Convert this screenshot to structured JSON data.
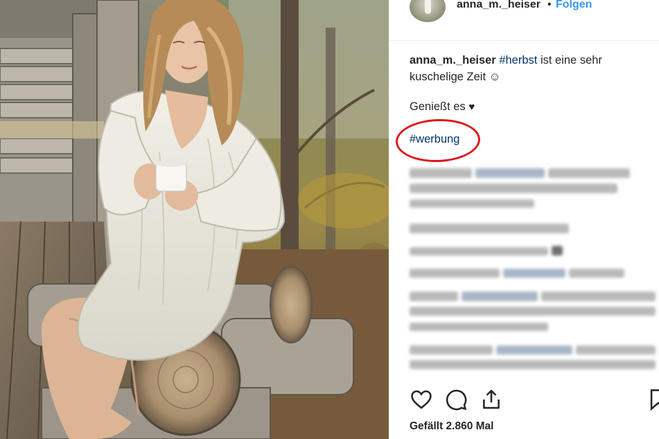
{
  "post": {
    "username": "anna_m._heiser",
    "separator": "•",
    "follow_label": "Folgen"
  },
  "caption": {
    "username": "anna_m._heiser",
    "hashtag": "#herbst",
    "text": " ist eine sehr kuschelige Zeit ☺",
    "line2": "Genießt es",
    "heart": "♥",
    "ad_hashtag": "#werbung"
  },
  "actions": {
    "like_icon": "heart-outline-icon",
    "comment_icon": "speech-bubble-icon",
    "share_icon": "share-arrow-icon",
    "save_icon": "bookmark-icon"
  },
  "likes_text": "Gefällt 2.860 Mal",
  "colors": {
    "link": "#003569",
    "follow": "#3897f0",
    "highlight_circle": "#e01919",
    "text": "#262626"
  }
}
